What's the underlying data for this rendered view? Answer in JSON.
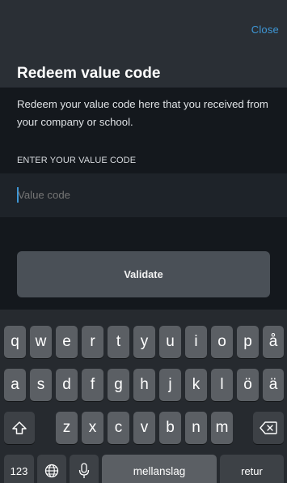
{
  "header": {
    "close_label": "Close"
  },
  "title": "Redeem value code",
  "description": "Redeem your value code here that you received from your company or school.",
  "field_label": "ENTER YOUR VALUE CODE",
  "code_input": {
    "placeholder": "Value code",
    "value": ""
  },
  "validate_label": "Validate",
  "keyboard": {
    "row1": [
      "q",
      "w",
      "e",
      "r",
      "t",
      "y",
      "u",
      "i",
      "o",
      "p",
      "å"
    ],
    "row2": [
      "a",
      "s",
      "d",
      "f",
      "g",
      "h",
      "j",
      "k",
      "l",
      "ö",
      "ä"
    ],
    "row3": [
      "z",
      "x",
      "c",
      "v",
      "b",
      "n",
      "m"
    ],
    "numbers_label": "123",
    "space_label": "mellanslag",
    "return_label": "retur"
  },
  "icons": {
    "shift": "shift-icon",
    "backspace": "backspace-icon",
    "globe": "globe-icon",
    "mic": "microphone-icon"
  },
  "colors": {
    "accent": "#3e97d6",
    "background": "#14181d",
    "button": "#4a5057"
  }
}
